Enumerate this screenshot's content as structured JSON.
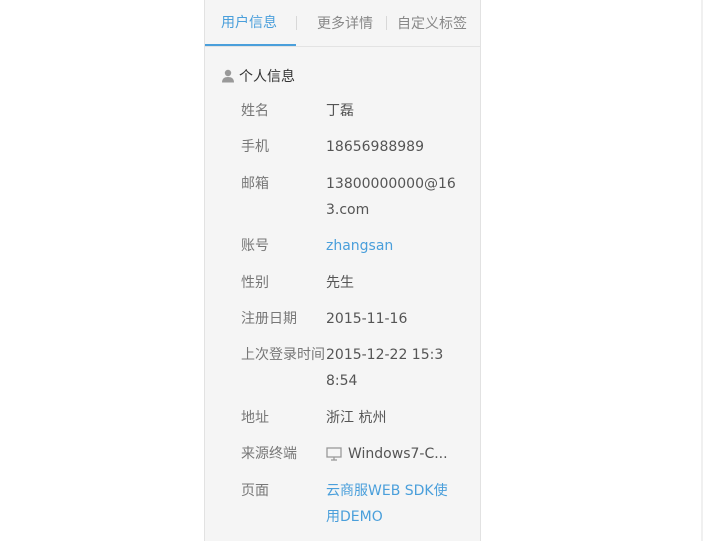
{
  "tabs": [
    "用户信息",
    "更多详情",
    "自定义标签"
  ],
  "section_title": "个人信息",
  "fields": {
    "name": {
      "label": "姓名",
      "value": "丁磊"
    },
    "phone": {
      "label": "手机",
      "value": "18656988989"
    },
    "email": {
      "label": "邮箱",
      "value": "13800000000@163.com"
    },
    "account": {
      "label": "账号",
      "value": "zhangsan"
    },
    "gender": {
      "label": "性别",
      "value": "先生"
    },
    "register_date": {
      "label": "注册日期",
      "value": "2015-11-16"
    },
    "last_login": {
      "label": "上次登录时间",
      "value": "2015-12-22 15:38:54"
    },
    "address": {
      "label": "地址",
      "value": "浙江 杭州"
    },
    "source": {
      "label": "来源终端",
      "value": "Windows7-C..."
    },
    "page": {
      "label": "页面",
      "value": "云商服WEB SDK使用DEMO"
    }
  },
  "colors": {
    "accent": "#4a9fdb",
    "panel_bg": "#f5f5f5"
  },
  "icons": {
    "section": "user-icon",
    "source": "monitor-icon"
  }
}
